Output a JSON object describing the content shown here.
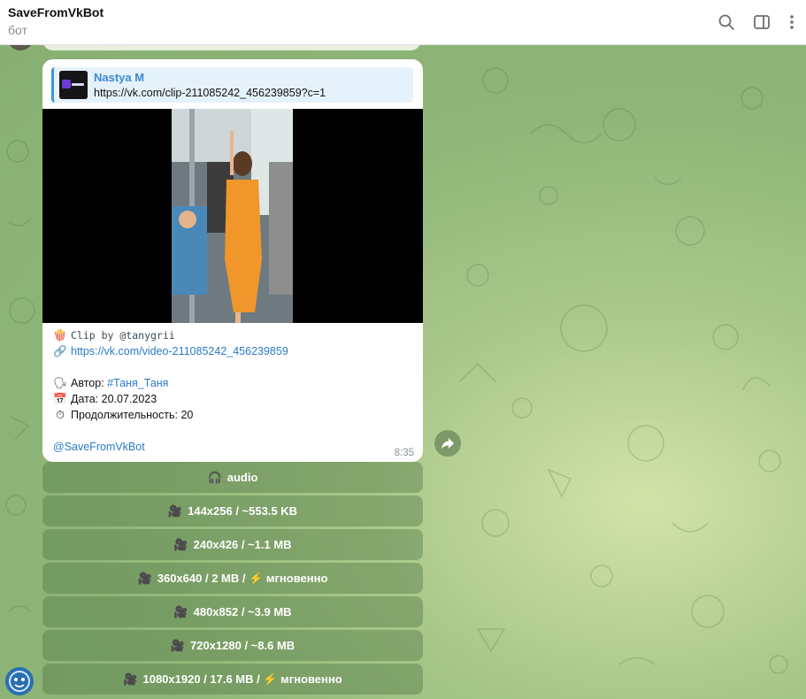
{
  "header": {
    "title": "SaveFromVkBot",
    "subtitle": "бот"
  },
  "message": {
    "reply": {
      "name": "Nastya M",
      "text": "https://vk.com/clip-211085242_456239859?c=1"
    },
    "clip_line": "Clip by @tanygrii",
    "video_link": "https://vk.com/video-211085242_456239859",
    "author_label": "Автор:",
    "author_value": "#Таня_Таня",
    "date_line": "Дата: 20.07.2023",
    "duration_line": "Продолжительность: 20",
    "bot_mention": "@SaveFromVkBot",
    "time": "8:35",
    "emojis": {
      "clip": "🍿",
      "link": "🔗",
      "author": "🗣",
      "date": "📅",
      "duration": "⏱"
    }
  },
  "keyboard": [
    {
      "icon": "🎧",
      "label": "audio"
    },
    {
      "icon": "🎥",
      "label": "144x256 / ~553.5 KB"
    },
    {
      "icon": "🎥",
      "label": "240x426 / ~1.1 MB"
    },
    {
      "icon": "🎥",
      "label": "360x640 / 2 MB / ⚡ мгновенно"
    },
    {
      "icon": "🎥",
      "label": "480x852 / ~3.9 MB"
    },
    {
      "icon": "🎥",
      "label": "720x1280 / ~8.6 MB"
    },
    {
      "icon": "🎥",
      "label": "1080x1920 / 17.6 MB / ⚡ мгновенно"
    }
  ],
  "icons": {
    "search": "search-icon",
    "sidebar": "sidebar-toggle-icon",
    "more": "more-vertical-icon",
    "share": "share-icon"
  },
  "colors": {
    "link": "#2b7bc4",
    "reply_bar": "#3a96dd",
    "button_bg": "#527846"
  }
}
